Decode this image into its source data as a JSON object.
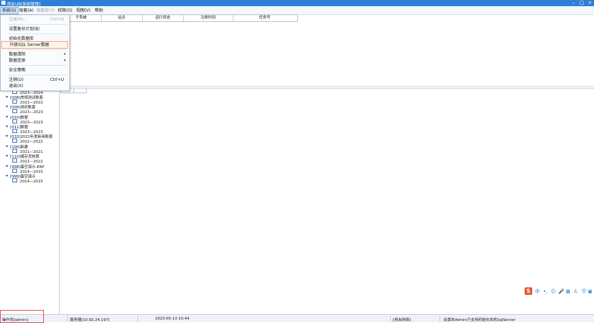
{
  "window": {
    "title": "用友U8[系统管理]",
    "controls": {
      "minimize": "–",
      "maximize": "□",
      "close": "×"
    }
  },
  "menubar": {
    "items": [
      {
        "label": "系统(S)",
        "state": "active"
      },
      {
        "label": "账套(A)",
        "state": "normal"
      },
      {
        "label": "账套库(Y)",
        "state": "disabled"
      },
      {
        "label": "权限(O)",
        "state": "normal"
      },
      {
        "label": "视图(V)",
        "state": "normal"
      },
      {
        "label": "帮助",
        "state": "normal"
      }
    ]
  },
  "system_menu": {
    "items": [
      {
        "label": "注册(R)...",
        "shortcut": "Ctrl+R",
        "state": "disabled"
      },
      {
        "label": "设置备份计划(B)",
        "shortcut": "",
        "state": "normal"
      },
      {
        "label": "初始化数据库",
        "shortcut": "",
        "state": "normal"
      },
      {
        "label": "升级SQL Server数据",
        "shortcut": "",
        "state": "highlighted"
      },
      {
        "label": "数据清除",
        "shortcut": "",
        "state": "submenu"
      },
      {
        "label": "数据还原",
        "shortcut": "",
        "state": "submenu"
      },
      {
        "label": "安全策略",
        "shortcut": "",
        "state": "normal"
      },
      {
        "label": "注销(U)",
        "shortcut": "Ctrl+U",
        "state": "normal"
      },
      {
        "label": "退出(X)",
        "shortcut": "",
        "state": "normal"
      }
    ],
    "submenu_glyph": "▸"
  },
  "grid": {
    "columns": [
      "子系统",
      "站点",
      "运行状态",
      "注册时间",
      "任务号"
    ]
  },
  "tree": {
    "nodes": [
      {
        "type": "year",
        "label": "2023—2024"
      },
      {
        "type": "account",
        "label": "[008]常规测试账套"
      },
      {
        "type": "year",
        "label": "2022—2022"
      },
      {
        "type": "account",
        "label": "[009]测初账套"
      },
      {
        "type": "year",
        "label": "2023—2023"
      },
      {
        "type": "account",
        "label": "[010]数据"
      },
      {
        "type": "year",
        "label": "2023—2023"
      },
      {
        "type": "account",
        "label": "[011]数据"
      },
      {
        "type": "year",
        "label": "2023—2023"
      },
      {
        "type": "account",
        "label": "[033]2022年度新用账套"
      },
      {
        "type": "year",
        "label": "2022—2022"
      },
      {
        "type": "account",
        "label": "[100]新建"
      },
      {
        "type": "year",
        "label": "2021—2021"
      },
      {
        "type": "account",
        "label": "[110]报存货核算"
      },
      {
        "type": "year",
        "label": "2022—2022"
      },
      {
        "type": "account",
        "label": "[998]蛋空演示-ERP"
      },
      {
        "type": "year",
        "label": "2014—2015"
      },
      {
        "type": "account",
        "label": "[999]蛋空演示"
      },
      {
        "type": "year",
        "label": "2014—2015"
      }
    ]
  },
  "statusbar": {
    "operator": "操作员[admin]",
    "server": "服务器[10.92.24.197]",
    "datetime": "2023-05-13 10:44",
    "network": "[用友网络]",
    "message": "此版本Admin只支持初始化本机SqlServer"
  },
  "ime": {
    "logo": "S",
    "mode": "中",
    "icons": [
      "•,",
      "☺",
      "🎤",
      "▦",
      "♙",
      "👕",
      "▣"
    ]
  },
  "colors": {
    "titlebar": "#2f7fd6",
    "menu_active": "#cfe3f9",
    "highlight_border": "#f0a18a",
    "tree_accent": "#2a6fc9",
    "annotation_red": "#e64b4b"
  }
}
